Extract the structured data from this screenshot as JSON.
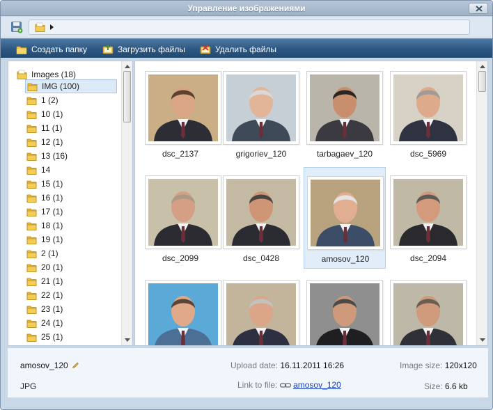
{
  "window": {
    "title": "Управление изображениями"
  },
  "toolbar": {
    "create_folder": "Создать папку",
    "upload_files": "Загрузить файлы",
    "delete_files": "Удалить файлы"
  },
  "tree": {
    "root_label": "Images (18)",
    "items": [
      {
        "label": "IMG (100)",
        "selected": true
      },
      {
        "label": "1 (2)"
      },
      {
        "label": "10 (1)"
      },
      {
        "label": "11 (1)"
      },
      {
        "label": "12 (1)"
      },
      {
        "label": "13 (16)"
      },
      {
        "label": "14"
      },
      {
        "label": "15 (1)"
      },
      {
        "label": "16 (1)"
      },
      {
        "label": "17 (1)"
      },
      {
        "label": "18 (1)"
      },
      {
        "label": "19 (1)"
      },
      {
        "label": "2 (1)"
      },
      {
        "label": "20 (1)"
      },
      {
        "label": "21 (1)"
      },
      {
        "label": "22 (1)"
      },
      {
        "label": "23 (1)"
      },
      {
        "label": "24 (1)"
      },
      {
        "label": "25 (1)"
      }
    ]
  },
  "files": [
    {
      "name": "dsc_2137",
      "bg": "#c9ae86",
      "suit": "#2d2d35",
      "skin": "#d9a584",
      "hair": "#5a4130"
    },
    {
      "name": "grigoriev_120",
      "bg": "#c6cfd6",
      "suit": "#3e4a57",
      "skin": "#e2b598",
      "hair": "#d8d8d8"
    },
    {
      "name": "tarbagaev_120",
      "bg": "#b9b5ab",
      "suit": "#3a3a40",
      "skin": "#c98e6b",
      "hair": "#2a2624"
    },
    {
      "name": "dsc_5969",
      "bg": "#d8d2c6",
      "suit": "#2f3341",
      "skin": "#deaa8c",
      "hair": "#9e9c98"
    },
    {
      "name": "dsc_2099",
      "bg": "#c8c0a8",
      "suit": "#2b2b31",
      "skin": "#d49f84",
      "hair": "#a89a85"
    },
    {
      "name": "dsc_0428",
      "bg": "#c4baa3",
      "suit": "#2a2c32",
      "skin": "#cf9676",
      "hair": "#4b4540"
    },
    {
      "name": "amosov_120",
      "bg": "#b9a37f",
      "suit": "#3c4d67",
      "skin": "#e1ae92",
      "hair": "#e4e4e4",
      "selected": true
    },
    {
      "name": "dsc_2094",
      "bg": "#bfb9a5",
      "suit": "#2a2a2e",
      "skin": "#d39b7c",
      "hair": "#5e5a55"
    },
    {
      "name": "",
      "bg": "#5aa9d6",
      "suit": "#4b6f95",
      "skin": "#e0a98a",
      "hair": "#5a4536"
    },
    {
      "name": "",
      "bg": "#c2b59c",
      "suit": "#2d3040",
      "skin": "#dba587",
      "hair": "#c2c2c2"
    },
    {
      "name": "",
      "bg": "#8f8f8f",
      "suit": "#1f1f22",
      "skin": "#cf9a7b",
      "hair": "#4a4a4a"
    },
    {
      "name": "",
      "bg": "#bdb8a8",
      "suit": "#2f3038",
      "skin": "#d09a7c",
      "hair": "#6a5e52"
    }
  ],
  "info": {
    "file_name": "amosov_120",
    "file_type": "JPG",
    "upload_date_label": "Upload date:",
    "upload_date": "16.11.2011 16:26",
    "link_label": "Link to file:",
    "link_text": "amosov_120",
    "image_size_label": "Image size:",
    "image_size": "120x120",
    "size_label": "Size:",
    "size": "6.6 kb"
  },
  "colors": {
    "toolbar": "#2c5782",
    "selection": "#dceaf8",
    "link": "#1a3fc1"
  }
}
